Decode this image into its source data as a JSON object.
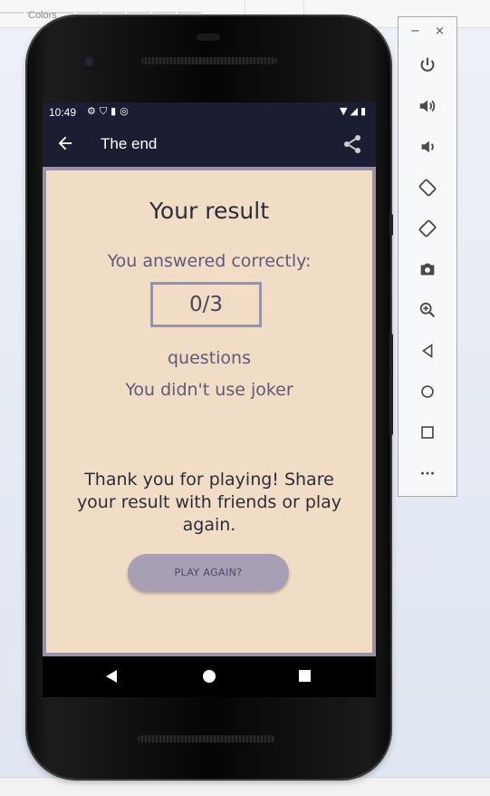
{
  "ide": {
    "colors_label": "Colors"
  },
  "status_bar": {
    "time": "10:49",
    "icons": [
      "settings-icon",
      "shield-icon",
      "sd-card-icon",
      "sync-icon"
    ],
    "right_icons": [
      "wifi-icon",
      "signal-icon",
      "battery-icon"
    ]
  },
  "app_bar": {
    "title": "The end",
    "back_icon": "arrow-left-icon",
    "share_icon": "share-icon",
    "background": "#1b1d33"
  },
  "result": {
    "title": "Your result",
    "answered_label": "You answered correctly:",
    "score": "0/3",
    "questions_label": "questions",
    "joker_text": "You didn't use joker",
    "thanks_text": "Thank you for playing! Share your result with friends or play again.",
    "play_again_label": "PLAY AGAIN?",
    "background": "#f1dcc6",
    "accent": "#9a91a7"
  },
  "nav_bar": {
    "buttons": [
      "back-triangle-icon",
      "home-circle-icon",
      "recents-square-icon"
    ]
  },
  "emulator_toolbar": {
    "window_controls": {
      "minimize": "−",
      "close": "×"
    },
    "buttons": [
      "power-icon",
      "volume-up-icon",
      "volume-down-icon",
      "rotate-left-icon",
      "rotate-right-icon",
      "camera-icon",
      "zoom-icon",
      "back-icon",
      "home-icon",
      "overview-icon",
      "more-icon"
    ]
  }
}
